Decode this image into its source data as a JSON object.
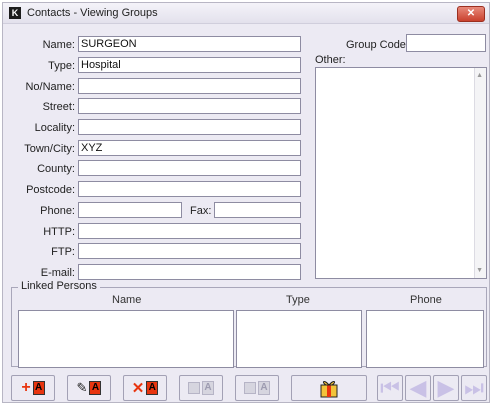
{
  "window": {
    "title": "Contacts - Viewing Groups",
    "close_label": "✕"
  },
  "form": {
    "name_label": "Name:",
    "name_value": "SURGEON",
    "type_label": "Type:",
    "type_value": "Hospital",
    "noname_label": "No/Name:",
    "noname_value": "",
    "street_label": "Street:",
    "street_value": "",
    "locality_label": "Locality:",
    "locality_value": "",
    "towncity_label": "Town/City:",
    "towncity_value": "XYZ",
    "county_label": "County:",
    "county_value": "",
    "postcode_label": "Postcode:",
    "postcode_value": "",
    "phone_label": "Phone:",
    "phone_value": "",
    "fax_label": "Fax:",
    "fax_value": "",
    "http_label": "HTTP:",
    "http_value": "",
    "ftp_label": "FTP:",
    "ftp_value": "",
    "email_label": "E-mail:",
    "email_value": "",
    "groupcode_label": "Group Code:",
    "groupcode_value": "",
    "other_label": "Other:",
    "other_value": ""
  },
  "linked": {
    "title": "Linked Persons",
    "columns": [
      "Name",
      "Type",
      "Phone"
    ]
  },
  "toolbar": {
    "icons": [
      "add-record-icon",
      "edit-record-icon",
      "delete-record-icon",
      "save-record-icon",
      "cancel-edit-icon",
      "gift-icon",
      "first-record-icon",
      "previous-record-icon",
      "next-record-icon",
      "last-record-icon"
    ],
    "badge_letter": "A"
  }
}
